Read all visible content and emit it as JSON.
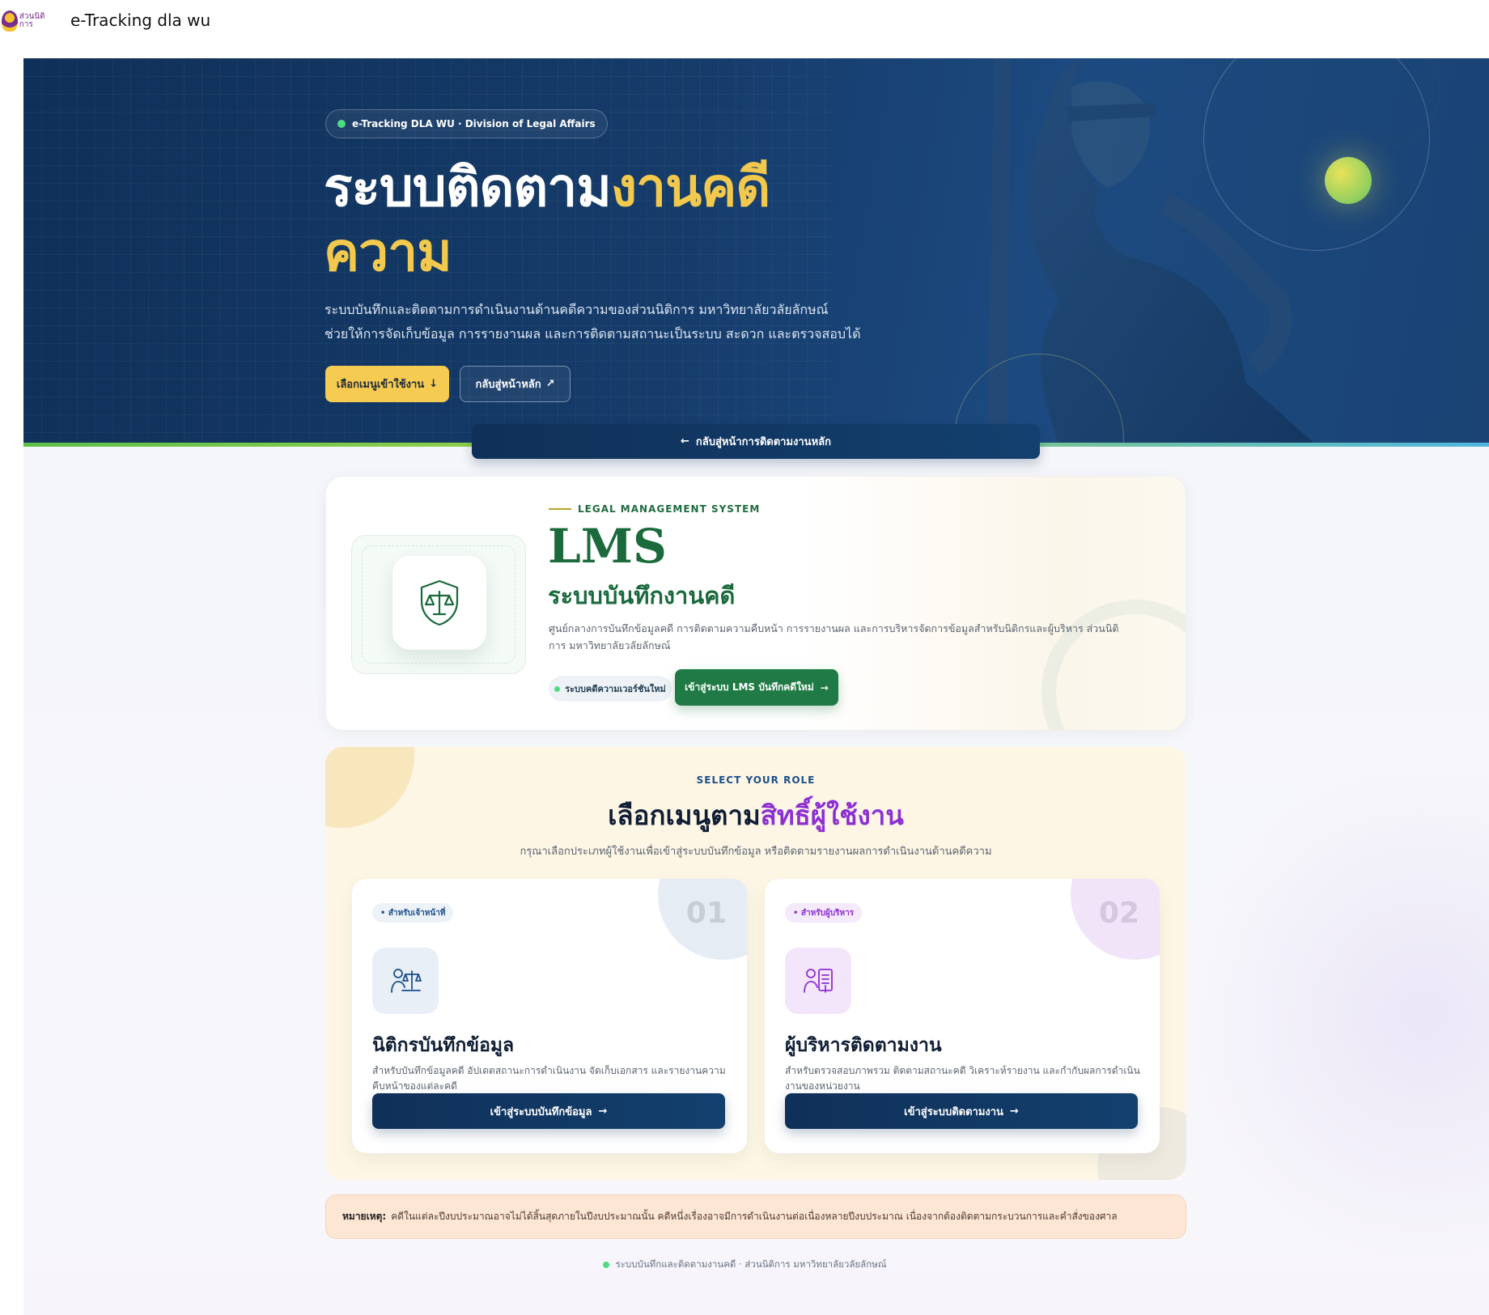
{
  "header": {
    "logo_text": "ส่วนนิติการ",
    "app_title": "e-Tracking dla wu"
  },
  "hero": {
    "pill": "e-Tracking DLA WU · Division of Legal Affairs",
    "title_part1": "ระบบติดตาม",
    "title_part2": "งานคดี",
    "title_part3": "ความ",
    "desc_line1": "ระบบบันทึกและติดตามการดำเนินงานด้านคดีความของส่วนนิติการ มหาวิทยาลัยวลัยลักษณ์",
    "desc_line2": "ช่วยให้การจัดเก็บข้อมูล การรายงานผล และการติดตามสถานะเป็นระบบ สะดวก และตรวจสอบได้",
    "btn_primary": "เลือกเมนูเข้าใช้งาน",
    "btn_primary_icon": "↓",
    "btn_ghost": "กลับสู่หน้าหลัก",
    "btn_ghost_icon": "↗"
  },
  "back_bar": {
    "icon": "←",
    "label": "กลับสู่หน้าการติดตามงานหลัก"
  },
  "lms": {
    "eyebrow": "LEGAL MANAGEMENT SYSTEM",
    "title": "LMS",
    "subtitle": "ระบบบันทึกงานคดี",
    "desc": "ศูนย์กลางการบันทึกข้อมูลคดี การติดตามความคืบหน้า การรายงานผล และการบริหารจัดการข้อมูลสำหรับนิติกรและผู้บริหาร ส่วนนิติการ มหาวิทยาลัยวลัยลักษณ์",
    "badge": "ระบบคดีความเวอร์ชันใหม่",
    "button": "เข้าสู่ระบบ LMS บันทึกคดีใหม่",
    "button_icon": "→"
  },
  "roles": {
    "eyebrow": "SELECT YOUR ROLE",
    "title_part1": "เลือกเมนูตาม",
    "title_part2": "สิทธิ์ผู้ใช้งาน",
    "desc": "กรุณาเลือกประเภทผู้ใช้งานเพื่อเข้าสู่ระบบบันทึกข้อมูล หรือติดตามรายงานผลการดำเนินงานด้านคดีความ",
    "items": [
      {
        "chip": "• สำหรับเจ้าหน้าที่",
        "number": "01",
        "name": "นิติกรบันทึกข้อมูล",
        "text": "สำหรับบันทึกข้อมูลคดี อัปเดตสถานะการดำเนินงาน จัดเก็บเอกสาร และรายงานความคืบหน้าของแต่ละคดี",
        "button": "เข้าสู่ระบบบันทึกข้อมูล",
        "button_icon": "→"
      },
      {
        "chip": "• สำหรับผู้บริหาร",
        "number": "02",
        "name": "ผู้บริหารติดตามงาน",
        "text": "สำหรับตรวจสอบภาพรวม ติดตามสถานะคดี วิเคราะห์รายงาน และกำกับผลการดำเนินงานของหน่วยงาน",
        "button": "เข้าสู่ระบบติดตามงาน",
        "button_icon": "→"
      }
    ]
  },
  "note": {
    "label": "หมายเหตุ:",
    "text": "คดีในแต่ละปีงบประมาณอาจไม่ได้สิ้นสุดภายในปีงบประมาณนั้น คดีหนึ่งเรื่องอาจมีการดำเนินงานต่อเนื่องหลายปีงบประมาณ เนื่องจากต้องติดตามกระบวนการและคำสั่งของศาล"
  },
  "footer": {
    "text": "ระบบบันทึกและติดตามงานคดี · ส่วนนิติการ มหาวิทยาลัยวลัยลักษณ์"
  },
  "colors": {
    "navy": "#0f3058",
    "gold": "#f2c94c",
    "green": "#1f7a45",
    "purple": "#8d2fd2"
  }
}
